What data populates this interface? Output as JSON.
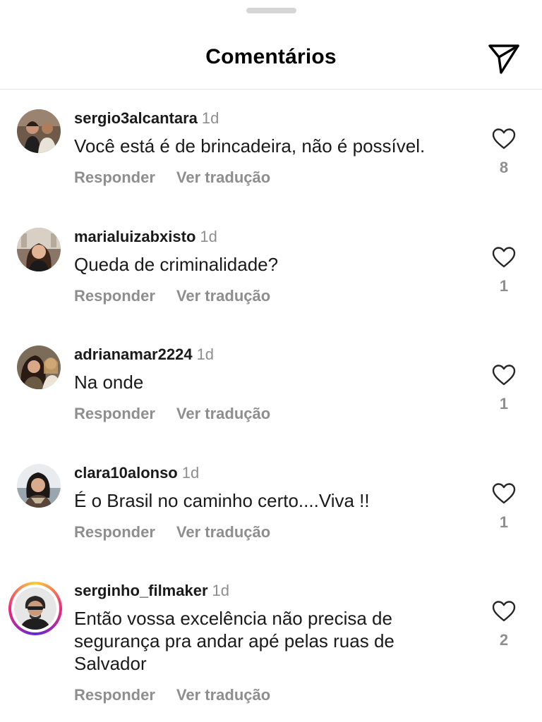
{
  "header": {
    "title": "Comentários",
    "share_icon": "paper-plane-icon"
  },
  "comment_labels": {
    "reply": "Responder",
    "translate": "Ver tradução"
  },
  "comments": [
    {
      "username": "sergio3alcantara",
      "time": "1d",
      "text": "Você está é de brincadeira, não é possível.",
      "likes": "8"
    },
    {
      "username": "marialuizabxisto",
      "time": "1d",
      "text": "Queda de criminalidade?",
      "likes": "1"
    },
    {
      "username": "adrianamar2224",
      "time": "1d",
      "text": "Na onde",
      "likes": "1"
    },
    {
      "username": "clara10alonso",
      "time": "1d",
      "text": "É o Brasil no caminho certo....Viva !!",
      "likes": "1"
    },
    {
      "username": "serginho_filmaker",
      "time": "1d",
      "text": "Então vossa excelência não precisa de segurança pra andar apé  pelas ruas de Salvador",
      "likes": "2"
    }
  ],
  "colors": {
    "secondary_text": "#8e8e8e",
    "divider": "#e6e6e6",
    "story_ring": "#ee2a7b"
  }
}
